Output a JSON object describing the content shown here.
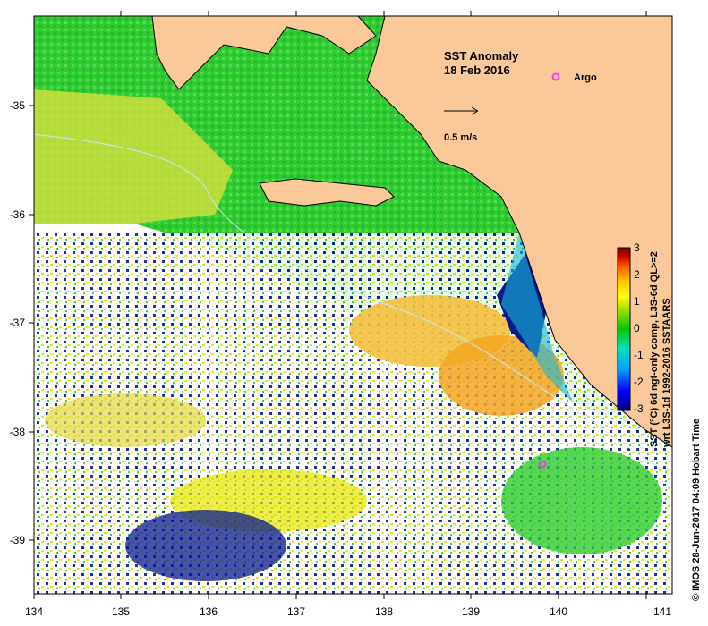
{
  "title": {
    "line1": "SST Anomaly",
    "line2": "18 Feb 2016"
  },
  "legend": {
    "argo_label": "Argo",
    "argo_color": "#ff33ff",
    "vector_scale_label": "0.5 m/s"
  },
  "colorbar": {
    "ticks": [
      "3",
      "2",
      "1",
      "0",
      "-1",
      "-2",
      "-3"
    ],
    "label_line1": "SST (°C) 6d ngt-only comp, L3S-6d QL>=2",
    "label_line2": "wrt L3S-1d 1992-2016 SSTAARS",
    "colors": [
      "#000080",
      "#0000ff",
      "#00a0ff",
      "#00e0c0",
      "#00c800",
      "#a0e000",
      "#ffff00",
      "#ffc000",
      "#ff6000",
      "#c00000",
      "#800000"
    ]
  },
  "credit": "© IMOS 28-Jun-2017 04:09 Hobart Time",
  "axes": {
    "x_ticks": [
      "134",
      "135",
      "136",
      "137",
      "138",
      "139",
      "140",
      "141"
    ],
    "y_ticks": [
      "-35",
      "-36",
      "-37",
      "-38",
      "-39"
    ]
  },
  "colors": {
    "land": "#fbc89a",
    "ocean_green": "#2ecc2e",
    "anomaly_yellow": "#e6e600",
    "anomaly_orange": "#f5a623",
    "cold_blue": "#0a1a8c",
    "cyan": "#18b8d8"
  },
  "markers": {
    "argo_float": {
      "lon": 139.8,
      "lat": -38.3
    }
  }
}
